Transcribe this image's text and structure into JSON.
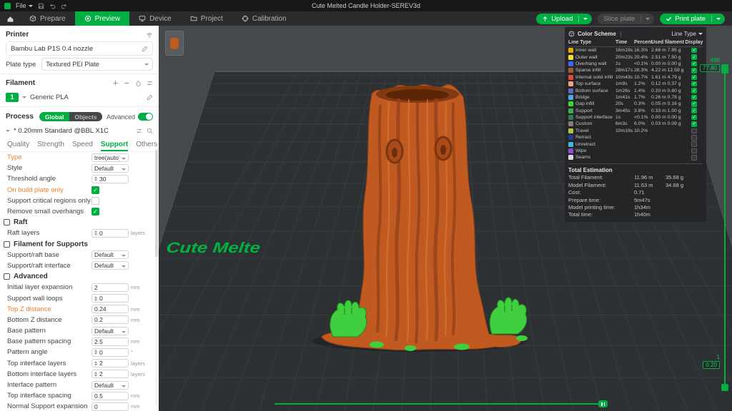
{
  "titlebar": {
    "file_menu": "File",
    "title": "Cute Melted Candle Holder-SEREV3d"
  },
  "tabbar": {
    "tabs": [
      {
        "label": "Prepare",
        "icon": "cube-icon",
        "active": false
      },
      {
        "label": "Preview",
        "icon": "preview-icon",
        "active": true
      },
      {
        "label": "Device",
        "icon": "device-icon",
        "active": false
      },
      {
        "label": "Project",
        "icon": "project-icon",
        "active": false
      },
      {
        "label": "Calibration",
        "icon": "calibration-icon",
        "active": false
      }
    ],
    "upload_label": "Upload",
    "slice_label": "Slice plate",
    "print_label": "Print plate"
  },
  "sidebar": {
    "printer": {
      "label": "Printer",
      "name": "Bambu Lab P1S 0.4 nozzle",
      "plate_type_label": "Plate type",
      "plate_type_value": "Textured PEI Plate"
    },
    "filament": {
      "label": "Filament",
      "slot": "1",
      "name": "Generic PLA"
    },
    "process": {
      "label": "Process",
      "global": "Global",
      "objects": "Objects",
      "advanced": "Advanced",
      "preset": "* 0.20mm Standard @BBL X1C"
    },
    "param_tabs": [
      {
        "label": "Quality",
        "active": false
      },
      {
        "label": "Strength",
        "active": false
      },
      {
        "label": "Speed",
        "active": false
      },
      {
        "label": "Support",
        "active": true
      },
      {
        "label": "Others",
        "active": false
      }
    ],
    "params": [
      {
        "label": "Type",
        "kind": "select",
        "value": "tree(auto)",
        "highlight": true
      },
      {
        "label": "Style",
        "kind": "select",
        "value": "Default"
      },
      {
        "label": "Threshold angle",
        "kind": "spin",
        "value": "30"
      },
      {
        "label": "On build plate only",
        "kind": "checkbox",
        "checked": true,
        "highlight": true
      },
      {
        "label": "Support critical regions only",
        "kind": "checkbox",
        "checked": false
      },
      {
        "label": "Remove small overhangs",
        "kind": "checkbox",
        "checked": true
      },
      {
        "label": "Raft",
        "kind": "section"
      },
      {
        "label": "Raft layers",
        "kind": "spin",
        "value": "0",
        "unit": "layers"
      },
      {
        "label": "Filament for Supports",
        "kind": "section"
      },
      {
        "label": "Support/raft base",
        "kind": "select",
        "value": "Default"
      },
      {
        "label": "Support/raft interface",
        "kind": "select",
        "value": "Default"
      },
      {
        "label": "Advanced",
        "kind": "section"
      },
      {
        "label": "Initial layer expansion",
        "kind": "input",
        "value": "2",
        "unit": "mm"
      },
      {
        "label": "Support wall loops",
        "kind": "spin",
        "value": "0"
      },
      {
        "label": "Top Z distance",
        "kind": "input",
        "value": "0.24",
        "unit": "mm",
        "highlight": true
      },
      {
        "label": "Bottom Z distance",
        "kind": "input",
        "value": "0.2",
        "unit": "mm"
      },
      {
        "label": "Base pattern",
        "kind": "select",
        "value": "Default"
      },
      {
        "label": "Base pattern spacing",
        "kind": "input",
        "value": "2.5",
        "unit": "mm"
      },
      {
        "label": "Pattern angle",
        "kind": "spin",
        "value": "0",
        "unit": "°"
      },
      {
        "label": "Top interface layers",
        "kind": "spin",
        "value": "2",
        "unit": "layers"
      },
      {
        "label": "Bottom interface layers",
        "kind": "spin",
        "value": "2",
        "unit": "layers"
      },
      {
        "label": "Interface pattern",
        "kind": "select",
        "value": "Default"
      },
      {
        "label": "Top interface spacing",
        "kind": "input",
        "value": "0.5",
        "unit": "mm"
      },
      {
        "label": "Normal Support expansion",
        "kind": "input",
        "value": "0",
        "unit": "mm"
      }
    ]
  },
  "legend": {
    "color_scheme_label": "Color Scheme",
    "view_type": "Line Type",
    "columns": [
      "Line Type",
      "Time",
      "Percent",
      "Used filament",
      "Display"
    ],
    "rows": [
      {
        "name": "Inner wall",
        "color": "#ECA800",
        "time": "16m19s",
        "percent": "16.3%",
        "filament": "2.66 m 7.95 g",
        "display": true
      },
      {
        "name": "Outer wall",
        "color": "#EDE32A",
        "time": "20m23s",
        "percent": "20.4%",
        "filament": "2.51 m 7.50 g",
        "display": true
      },
      {
        "name": "Overhang wall",
        "color": "#3A66F5",
        "time": "1s",
        "percent": "<0.1%",
        "filament": "0.00 m 0.00 g",
        "display": true
      },
      {
        "name": "Sparse infill",
        "color": "#A65A2A",
        "time": "28m17s",
        "percent": "28.3%",
        "filament": "4.22 m 12.59 g",
        "display": true
      },
      {
        "name": "Internal solid infill",
        "color": "#D94E3A",
        "time": "10m43s",
        "percent": "10.7%",
        "filament": "1.61 m 4.79 g",
        "display": true
      },
      {
        "name": "Top surface",
        "color": "#F0A083",
        "time": "1m9s",
        "percent": "1.2%",
        "filament": "0.12 m 0.37 g",
        "display": true
      },
      {
        "name": "Bottom surface",
        "color": "#5C6BC0",
        "time": "1m26s",
        "percent": "1.4%",
        "filament": "0.20 m 0.60 g",
        "display": true
      },
      {
        "name": "Bridge",
        "color": "#4FA8DE",
        "time": "1m41s",
        "percent": "1.7%",
        "filament": "0.26 m 0.78 g",
        "display": true
      },
      {
        "name": "Gap infill",
        "color": "#2EE02E",
        "time": "20s",
        "percent": "0.3%",
        "filament": "0.05 m 0.16 g",
        "display": true
      },
      {
        "name": "Support",
        "color": "#3FAE4A",
        "time": "3m45s",
        "percent": "3.8%",
        "filament": "0.33 m 1.00 g",
        "display": true
      },
      {
        "name": "Support interface",
        "color": "#2F7D4F",
        "time": "1s",
        "percent": "<0.1%",
        "filament": "0.00 m 0.00 g",
        "display": true
      },
      {
        "name": "Custom",
        "color": "#808080",
        "time": "6m3s",
        "percent": "6.0%",
        "filament": "0.03 m 0.09 g",
        "display": true
      },
      {
        "name": "Travel",
        "color": "#AEC93F",
        "time": "10m19s",
        "percent": "10.2%",
        "filament": "",
        "display": false
      },
      {
        "name": "Retract",
        "color": "#203C8F",
        "time": "",
        "percent": "",
        "filament": "",
        "display": false
      },
      {
        "name": "Unretract",
        "color": "#38BDE0",
        "time": "",
        "percent": "",
        "filament": "",
        "display": false
      },
      {
        "name": "Wipe",
        "color": "#8D4BD8",
        "time": "",
        "percent": "",
        "filament": "",
        "display": false
      },
      {
        "name": "Seams",
        "color": "#D9D9D9",
        "time": "",
        "percent": "",
        "filament": "",
        "display": false
      }
    ],
    "totals": {
      "title": "Total Estimation",
      "rows": [
        {
          "label": "Total Filament:",
          "v1": "11.96 m",
          "v2": "35.68 g"
        },
        {
          "label": "Model Filament:",
          "v1": "11.63 m",
          "v2": "34.68 g"
        },
        {
          "label": "Cost:",
          "v1": "0.71",
          "v2": ""
        },
        {
          "label": "Prepare time:",
          "v1": "5m47s",
          "v2": ""
        },
        {
          "label": "Model printing time:",
          "v1": "1h34m",
          "v2": ""
        },
        {
          "label": "Total time:",
          "v1": "1h40m",
          "v2": ""
        }
      ]
    }
  },
  "sliders": {
    "layer_top": "486",
    "height_top": "77.80",
    "layer_bottom": "1",
    "height_bottom": "0.20"
  },
  "viewport": {
    "plate_text": "Cute Melte"
  },
  "colors": {
    "accent": "#00AE42",
    "model": "#C05A20",
    "support": "#3FCF3F",
    "highlight_param": "#EE7E2C"
  },
  "icons": [
    "app-logo",
    "caret-down-icon",
    "save-icon",
    "undo-icon",
    "redo-icon",
    "home-icon",
    "cube-icon",
    "preview-icon",
    "device-icon",
    "project-icon",
    "calibration-icon",
    "upload-icon",
    "check-icon",
    "wifi-icon",
    "edit-icon",
    "plus-icon",
    "minus-icon",
    "flush-icon",
    "sliders-icon",
    "search-icon",
    "palette-icon",
    "spinner-arrows",
    "section-icon"
  ]
}
